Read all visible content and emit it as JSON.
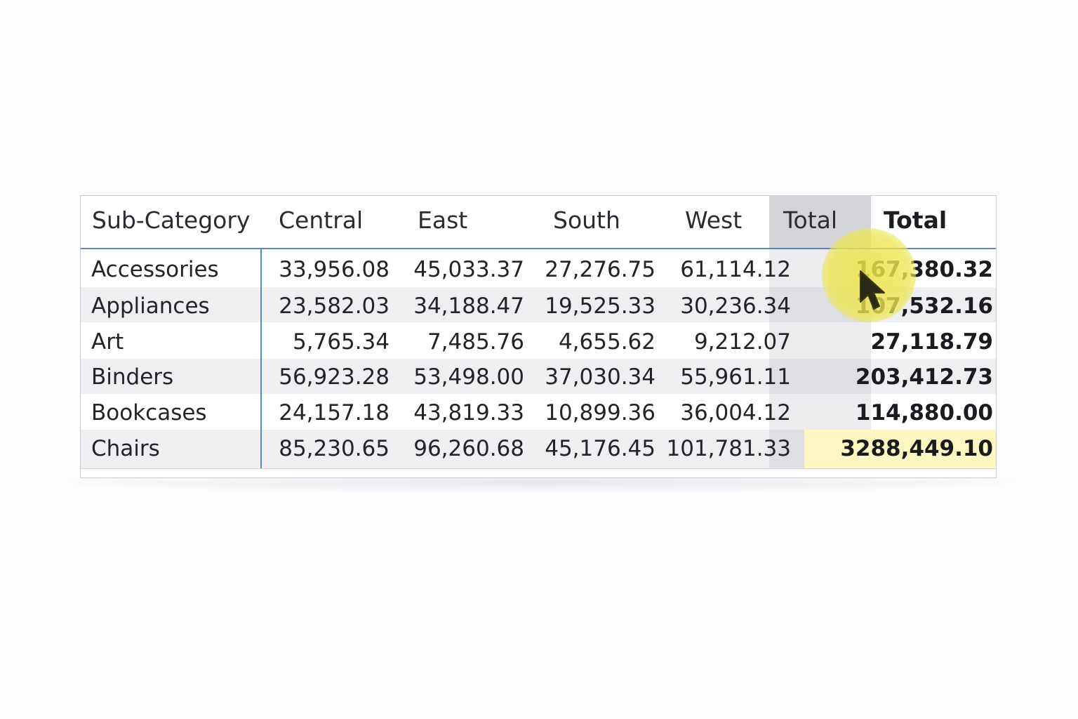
{
  "matrix": {
    "headers": {
      "subcategory": "Sub-Category",
      "central": "Central",
      "east": "East",
      "south": "South",
      "west": "West",
      "total_col": "Total",
      "total_row": "Total"
    },
    "rows": [
      {
        "name": "Accessories",
        "central": "33,956.08",
        "east": "45,033.37",
        "south": "27,276.75",
        "west": "61,114.12",
        "total": "167,380.32"
      },
      {
        "name": "Appliances",
        "central": "23,582.03",
        "east": "34,188.47",
        "south": "19,525.33",
        "west": "30,236.34",
        "total": "107,532.16"
      },
      {
        "name": "Art",
        "central": "5,765.34",
        "east": "7,485.76",
        "south": "4,655.62",
        "west": "9,212.07",
        "total": "27,118.79"
      },
      {
        "name": "Binders",
        "central": "56,923.28",
        "east": "53,498.00",
        "south": "37,030.34",
        "west": "55,961.11",
        "total": "203,412.73"
      },
      {
        "name": "Bookcases",
        "central": "24,157.18",
        "east": "43,819.33",
        "south": "10,899.36",
        "west": "36,004.12",
        "total": "114,880.00"
      },
      {
        "name": "Chairs",
        "central": "85,230.65",
        "east": "96,260.68",
        "south": "45,176.45",
        "west": "101,781.33",
        "total": "3288,449.10"
      }
    ]
  },
  "colors": {
    "accent_line": "#5a86c6",
    "highlight_yellow": "#fdf6c0",
    "cursor_glow": "#ece246"
  },
  "cursor": {
    "icon": "pointer-arrow-icon"
  }
}
